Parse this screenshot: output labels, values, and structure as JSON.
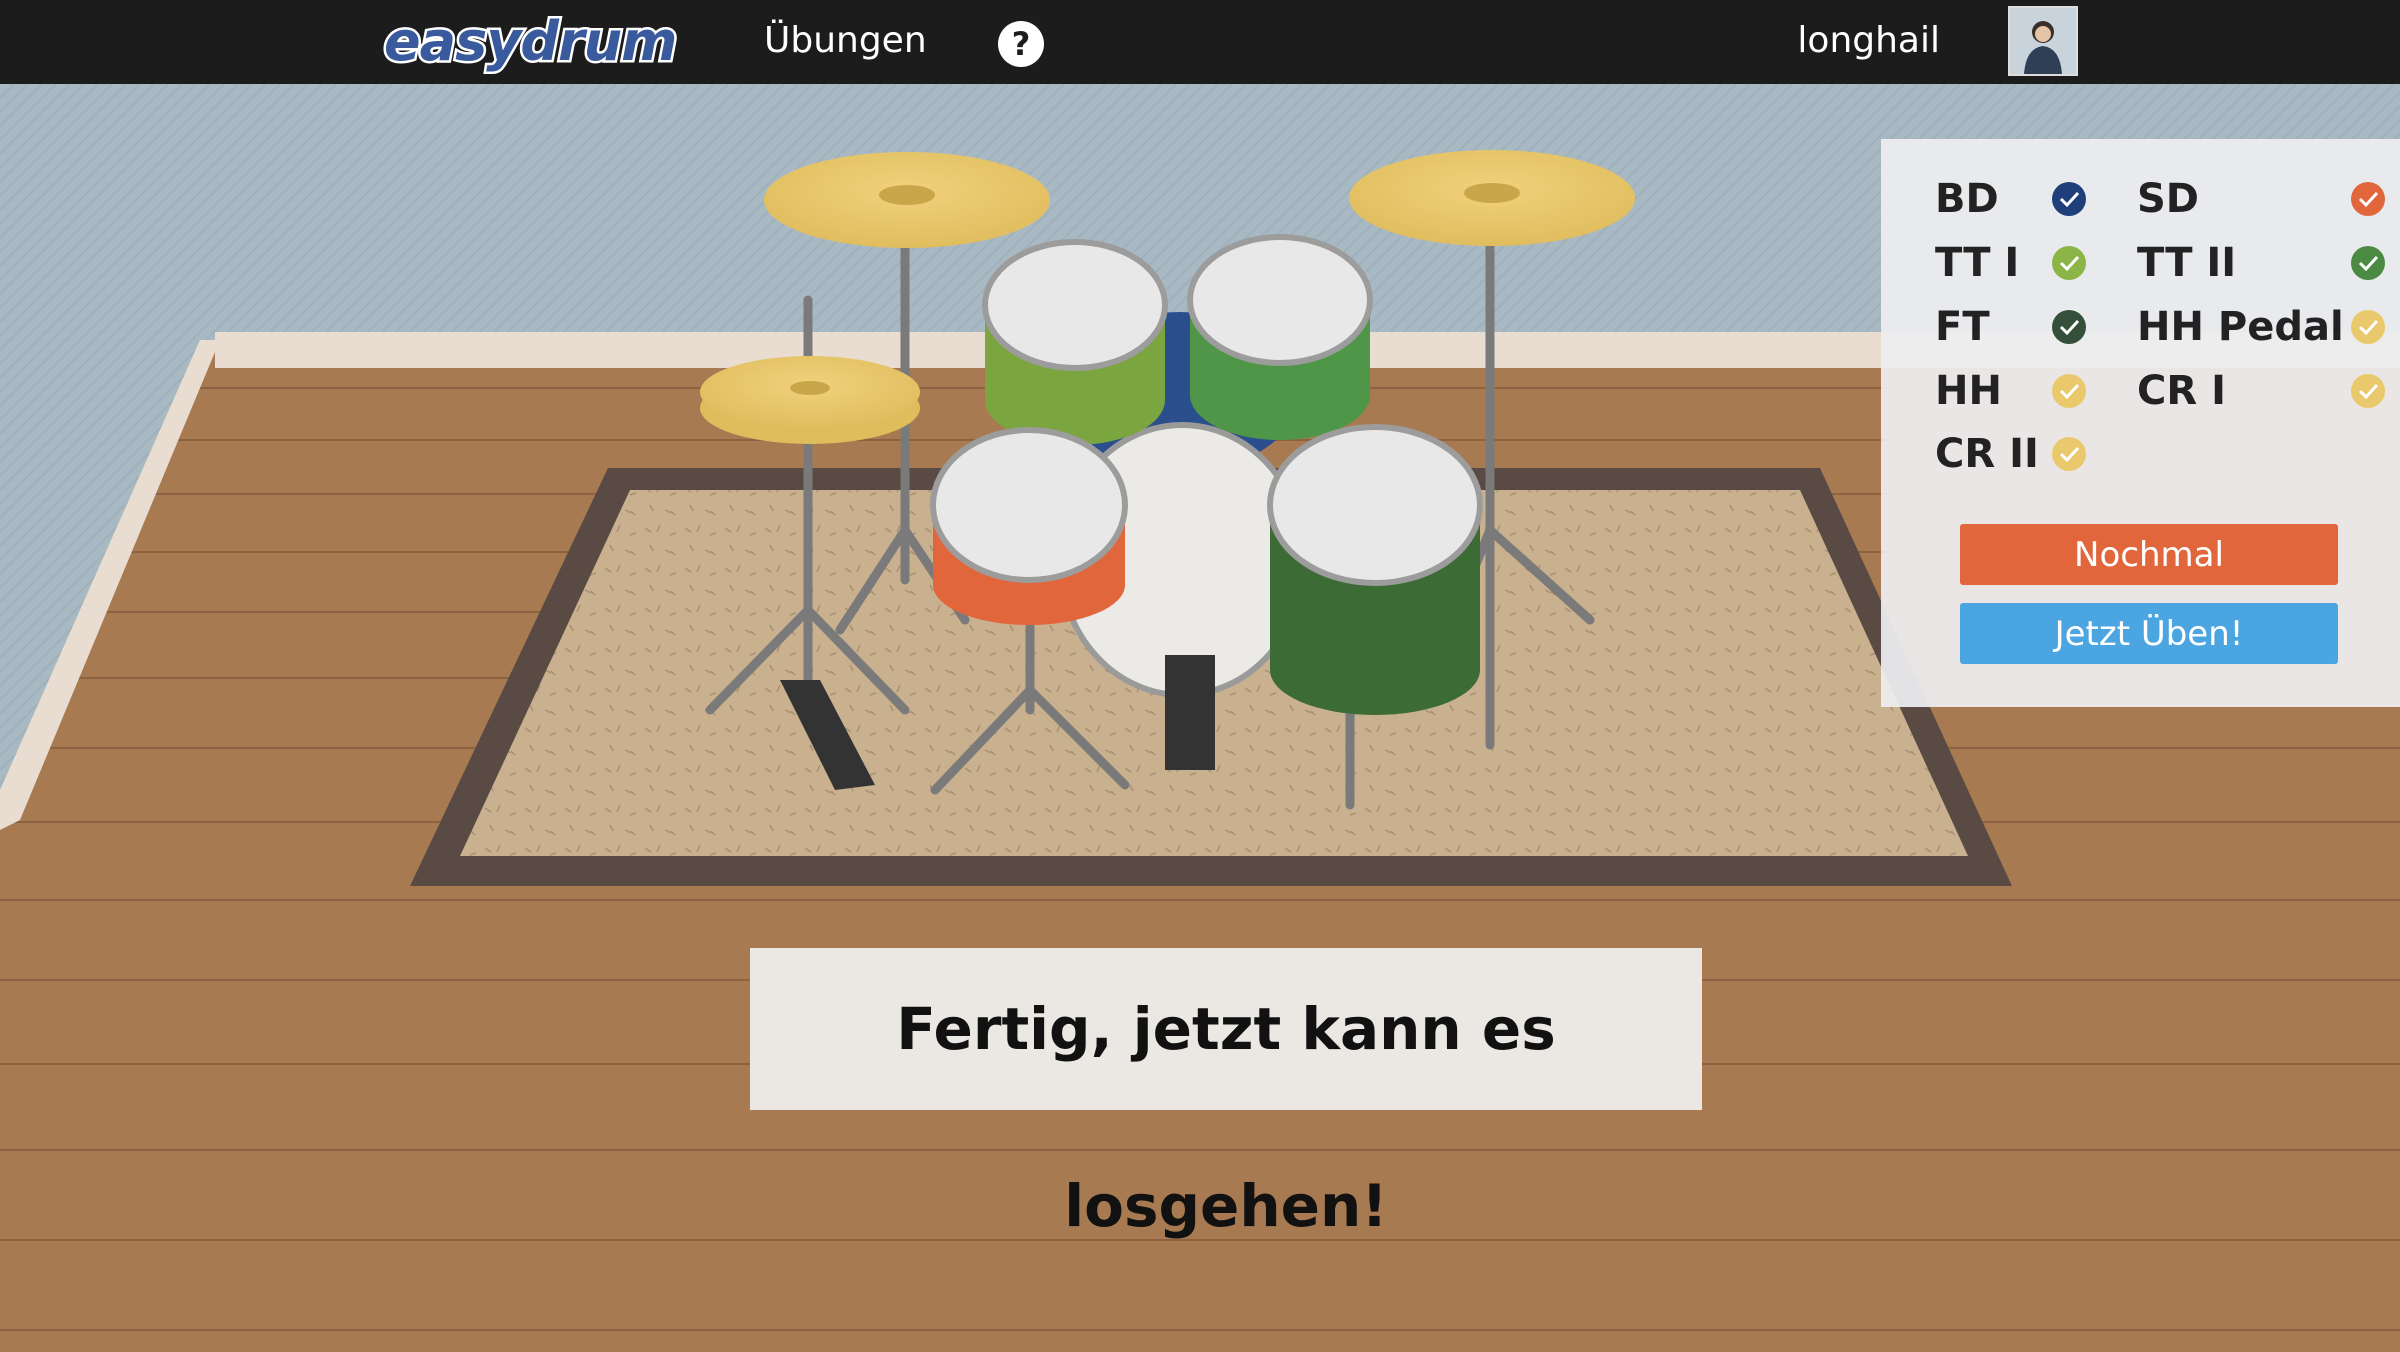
{
  "header": {
    "logo_text": "easydrum",
    "nav_exercises": "Übungen",
    "help_symbol": "?",
    "username": "longhail"
  },
  "status": {
    "items": [
      {
        "label": "BD",
        "color": "#1f3f7a",
        "icon": "check-icon"
      },
      {
        "label": "SD",
        "color": "#e2663c",
        "icon": "check-icon"
      },
      {
        "label": "TT I",
        "color": "#8cb548",
        "icon": "check-icon"
      },
      {
        "label": "TT II",
        "color": "#4a8a43",
        "icon": "check-icon"
      },
      {
        "label": "FT",
        "color": "#34503a",
        "icon": "check-icon"
      },
      {
        "label": "HH Pedal",
        "color": "#e9c96b",
        "icon": "check-icon"
      },
      {
        "label": "HH",
        "color": "#e9c96b",
        "icon": "check-icon"
      },
      {
        "label": "CR I",
        "color": "#e9c96b",
        "icon": "check-icon"
      },
      {
        "label": "CR II",
        "color": "#e9c96b",
        "icon": "check-icon"
      }
    ],
    "again_button": "Nochmal",
    "practice_button": "Jetzt Üben!"
  },
  "message": "Fertig, jetzt kann es losgehen!",
  "colors": {
    "topbar": "#1c1c1c",
    "wall": "#a9b9c4",
    "floor": "#a87a52",
    "rug": "#c6ad8c",
    "cymbal": "#e6c56a",
    "snare": "#e2663c",
    "tom1": "#7aa53f",
    "tom2": "#4f9648",
    "floor_tom": "#3d6b36",
    "bass_drum_shell": "#2a4f8c"
  }
}
